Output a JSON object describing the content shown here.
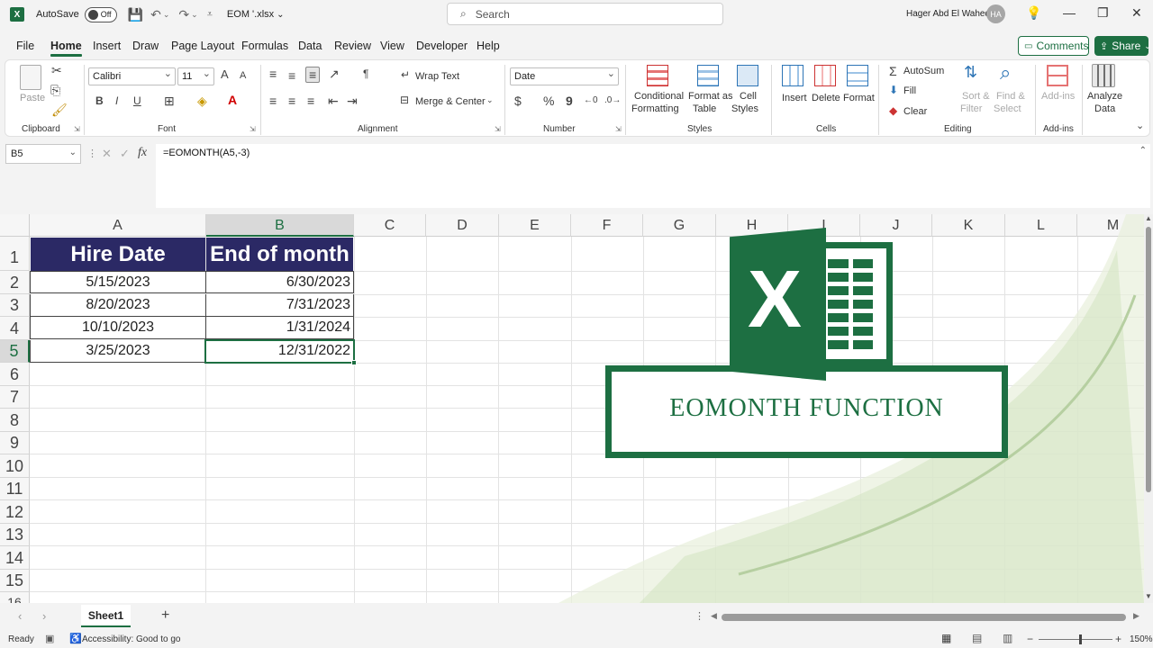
{
  "titlebar": {
    "app_icon": "X",
    "autosave_label": "AutoSave",
    "autosave_state": "Off",
    "filename": "EOM '.xlsx",
    "search_placeholder": "Search",
    "user_name": "Hager Abd El Wahed",
    "user_initials": "HA"
  },
  "menu": {
    "items": [
      "File",
      "Home",
      "Insert",
      "Draw",
      "Page Layout",
      "Formulas",
      "Data",
      "Review",
      "View",
      "Developer",
      "Help"
    ],
    "active": "Home",
    "comments_label": "Comments",
    "share_label": "Share"
  },
  "ribbon": {
    "clipboard": {
      "paste": "Paste",
      "label": "Clipboard"
    },
    "font": {
      "name": "Calibri",
      "size": "11",
      "bold": "B",
      "italic": "I",
      "underline": "U",
      "grow": "A",
      "shrink": "A",
      "label": "Font"
    },
    "alignment": {
      "wrap_text": "Wrap Text",
      "merge_center": "Merge & Center",
      "label": "Alignment"
    },
    "number": {
      "format": "Date",
      "currency": "$",
      "percent": "%",
      "comma": "9",
      "label": "Number"
    },
    "styles": {
      "conditional": "Conditional",
      "conditional2": "Formatting",
      "format_as": "Format as",
      "format_as2": "Table",
      "cell": "Cell",
      "cell2": "Styles",
      "label": "Styles"
    },
    "cells": {
      "insert": "Insert",
      "delete": "Delete",
      "format": "Format",
      "label": "Cells"
    },
    "editing": {
      "autosum": "AutoSum",
      "fill": "Fill",
      "clear": "Clear",
      "sort": "Sort &",
      "sort2": "Filter",
      "find": "Find &",
      "find2": "Select",
      "label": "Editing"
    },
    "addins": {
      "addins": "Add-ins",
      "label": "Add-ins"
    },
    "analyze": {
      "line1": "Analyze",
      "line2": "Data"
    }
  },
  "formula_bar": {
    "name_box": "B5",
    "formula": "=EOMONTH(A5,-3)",
    "fx": "fx"
  },
  "grid": {
    "columns": [
      "A",
      "B",
      "C",
      "D",
      "E",
      "F",
      "G",
      "H",
      "I",
      "J",
      "K",
      "L",
      "M"
    ],
    "rows": [
      "1",
      "2",
      "3",
      "4",
      "5",
      "6",
      "7",
      "8",
      "9",
      "10",
      "11",
      "12",
      "13",
      "14",
      "15",
      "16"
    ],
    "selected_column": "B",
    "selected_row": "5",
    "header_a": "Hire Date",
    "header_b": "End of month",
    "hire_dates": [
      "5/15/2023",
      "8/20/2023",
      "10/10/2023",
      "3/25/2023"
    ],
    "end_of_month": [
      "6/30/2023",
      "7/31/2023",
      "1/31/2024",
      "12/31/2022"
    ]
  },
  "banner": {
    "logo_letter": "X",
    "text": "EOMONTH FUNCTION",
    "color": "#1d6f42"
  },
  "sheet_tabs": {
    "active": "Sheet1",
    "add": "+"
  },
  "status": {
    "ready": "Ready",
    "accessibility": "Accessibility: Good to go",
    "zoom": "150%"
  }
}
